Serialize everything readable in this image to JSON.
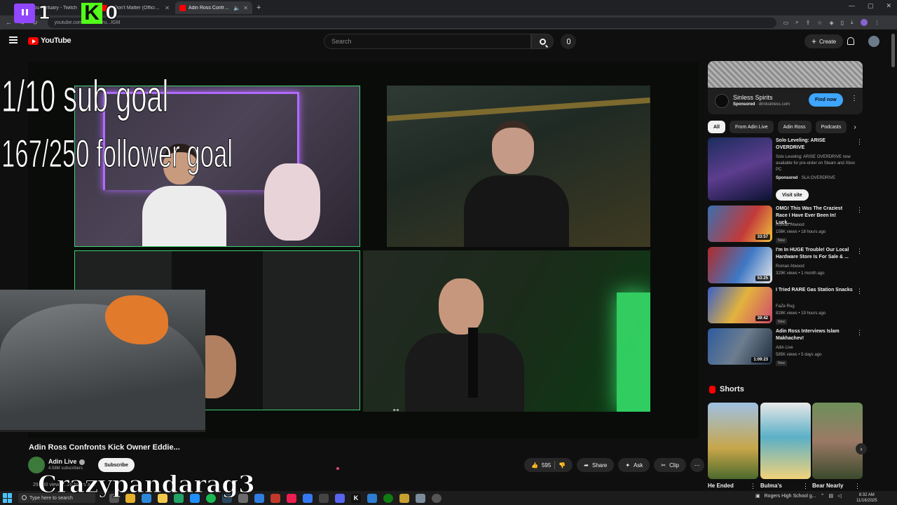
{
  "browser": {
    "tabs": [
      {
        "title": "vou...ertuary - Twitch",
        "favicon_color": "#9146ff"
      },
      {
        "title": "...Don't Matter (Official M",
        "favicon_color": "#ff0000"
      },
      {
        "title": "Adin Ross Confronts Kick O",
        "favicon_color": "#ff0000",
        "active": true
      }
    ],
    "url": "youtube.com/wa...   ...Tru...IGM"
  },
  "overlay": {
    "twitch_count": "1",
    "kick_label": "K",
    "kick_count": "0",
    "sub_goal": "1/10 sub goal",
    "follower_goal": "167/250 follower goal",
    "streamer_name": "Crazypandarag3"
  },
  "header": {
    "logo_text": "YouTube",
    "search_placeholder": "Search",
    "create_label": "Create"
  },
  "video": {
    "title": "Adin Ross Confronts Kick Owner Eddie...",
    "channel": "Adin Live",
    "subscribers": "4.58M subscribers",
    "subscribe_label": "Subscribe",
    "views_line": "29...40 views  ...20 hours ago",
    "likes": "595",
    "share_label": "Share",
    "ask_label": "Ask",
    "clip_label": "Clip"
  },
  "sidebar": {
    "ad": {
      "title": "Sinless Spirits",
      "sponsored": "Sponsored",
      "domain": "drinksinless.com",
      "cta": "Find now"
    },
    "chips": [
      "All",
      "From Adin Live",
      "Adin Ross",
      "Podcasts"
    ],
    "recommendations": [
      {
        "title": "Solo Leveling: ARISE OVERDRIVE",
        "desc": "Solo Leveling: ARISE OVERDRIVE now available for pre-order on Steam and Xbox PC",
        "sponsored": "Sponsored",
        "advertiser": "SLA:OVERDRIVE",
        "cta": "Visit site"
      },
      {
        "title": "OMG! This Was The Craziest Race I Have Ever Been In! Luck...",
        "channel": "Roman Atwood",
        "stats": "156K views • 18 hours ago",
        "badge": "New",
        "duration": "33:57"
      },
      {
        "title": "I'm In HUGE Trouble! Our Local Hardware Store Is For Sale & ...",
        "channel": "Roman Atwood",
        "stats": "329K views • 1 month ago",
        "duration": "53:25"
      },
      {
        "title": "I Tried RARE Gas Station Snacks",
        "channel": "FaZe Rug",
        "stats": "828K views • 19 hours ago",
        "badge": "New",
        "duration": "39:42"
      },
      {
        "title": "Adin Ross Interviews Islam Makhachev!",
        "channel": "Adin Live",
        "stats": "585K views • 5 days ago",
        "badge": "New",
        "duration": "1:09:23"
      }
    ],
    "shorts_label": "Shorts",
    "shorts": [
      {
        "title": "He Ended"
      },
      {
        "title": "Bulma's"
      },
      {
        "title": "Bear Nearly"
      }
    ]
  },
  "taskbar": {
    "search_placeholder": "Type here to search",
    "weather": "Rogers High School g...",
    "time": "8:32 AM",
    "date": "11/16/2025"
  },
  "colors": {
    "accent_blue": "#3ea6ff",
    "youtube_red": "#ff0000",
    "camera_border": "#3bd16f"
  }
}
